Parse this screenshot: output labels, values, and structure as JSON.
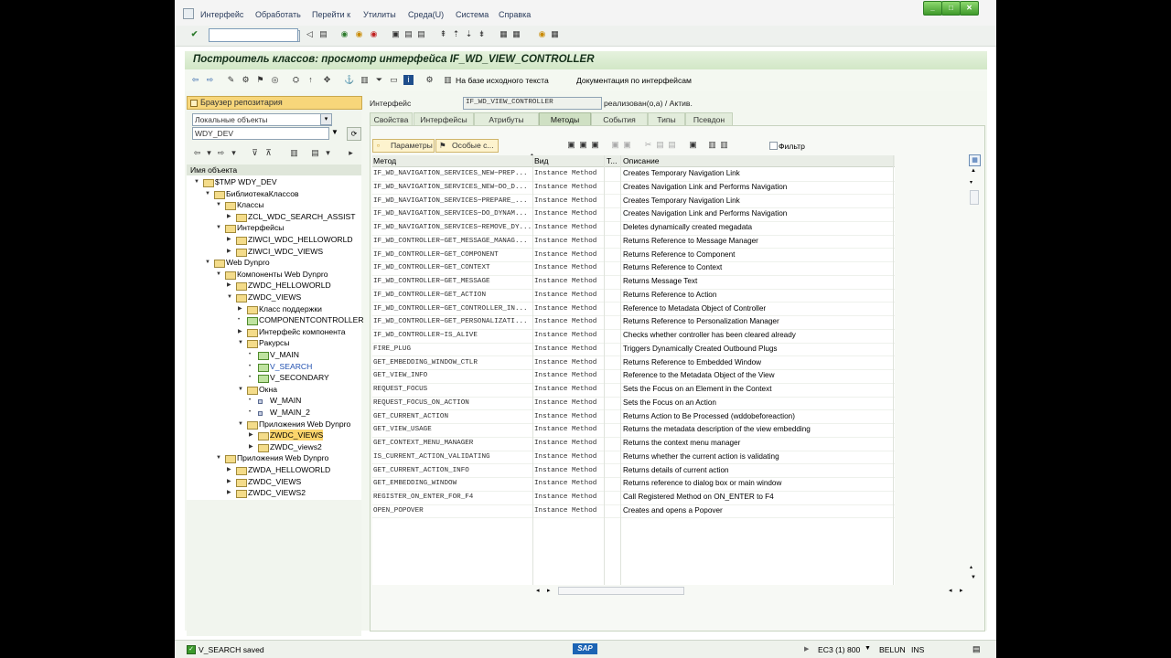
{
  "menubar": {
    "items": [
      "Интерфейс",
      "Обработать",
      "Перейти к",
      "Утилиты",
      "Среда(U)",
      "Система",
      "Справка"
    ]
  },
  "title": "Построитель классов: просмотр интерфейса IF_WD_VIEW_CONTROLLER",
  "app_toolbar": {
    "source_label": "На базе исходного текста",
    "doc_label": "Документация по интерфейсам"
  },
  "left": {
    "browser_title": "Браузер репозитария",
    "object_type": "Локальные объекты",
    "object_name": "WDY_DEV",
    "tree_header": "Имя объекта",
    "tree": [
      {
        "label": "$TMP WDY_DEV",
        "level": 0,
        "exp": "▼",
        "icon": "folder"
      },
      {
        "label": "БиблиотекаКлассов",
        "level": 1,
        "exp": "▼",
        "icon": "folder"
      },
      {
        "label": "Классы",
        "level": 2,
        "exp": "▼",
        "icon": "folder"
      },
      {
        "label": "ZCL_WDC_SEARCH_ASSIST",
        "level": 3,
        "exp": "▶",
        "icon": "folder"
      },
      {
        "label": "Интерфейсы",
        "level": 2,
        "exp": "▼",
        "icon": "folder"
      },
      {
        "label": "ZIWCI_WDC_HELLOWORLD",
        "level": 3,
        "exp": "▶",
        "icon": "folder"
      },
      {
        "label": "ZIWCI_WDC_VIEWS",
        "level": 3,
        "exp": "▶",
        "icon": "folder"
      },
      {
        "label": "Web Dynpro",
        "level": 1,
        "exp": "▼",
        "icon": "folder"
      },
      {
        "label": "Компоненты Web Dynpro",
        "level": 2,
        "exp": "▼",
        "icon": "folder"
      },
      {
        "label": "ZWDC_HELLOWORLD",
        "level": 3,
        "exp": "▶",
        "icon": "folder"
      },
      {
        "label": "ZWDC_VIEWS",
        "level": 3,
        "exp": "▼",
        "icon": "folder"
      },
      {
        "label": "Класс поддержки",
        "level": 4,
        "exp": "▶",
        "icon": "folder"
      },
      {
        "label": "COMPONENTCONTROLLER",
        "level": 4,
        "exp": "•",
        "icon": "obj"
      },
      {
        "label": "Интерфейс компонента",
        "level": 4,
        "exp": "▶",
        "icon": "folder"
      },
      {
        "label": "Ракурсы",
        "level": 4,
        "exp": "▼",
        "icon": "folder"
      },
      {
        "label": "V_MAIN",
        "level": 5,
        "exp": "•",
        "icon": "obj"
      },
      {
        "label": "V_SEARCH",
        "level": 5,
        "exp": "•",
        "icon": "obj",
        "blue": true
      },
      {
        "label": "V_SECONDARY",
        "level": 5,
        "exp": "•",
        "icon": "obj"
      },
      {
        "label": "Окна",
        "level": 4,
        "exp": "▼",
        "icon": "folder"
      },
      {
        "label": "W_MAIN",
        "level": 5,
        "exp": "•",
        "icon": "item"
      },
      {
        "label": "W_MAIN_2",
        "level": 5,
        "exp": "•",
        "icon": "item"
      },
      {
        "label": "Приложения Web Dynpro",
        "level": 4,
        "exp": "▼",
        "icon": "folder"
      },
      {
        "label": "ZWDC_VIEWS",
        "level": 5,
        "exp": "▶",
        "icon": "folder",
        "selected": true
      },
      {
        "label": "ZWDC_views2",
        "level": 5,
        "exp": "▶",
        "icon": "folder"
      },
      {
        "label": "Приложения Web Dynpro",
        "level": 2,
        "exp": "▼",
        "icon": "folder"
      },
      {
        "label": "ZWDA_HELLOWORLD",
        "level": 3,
        "exp": "▶",
        "icon": "folder"
      },
      {
        "label": "ZWDC_VIEWS",
        "level": 3,
        "exp": "▶",
        "icon": "folder"
      },
      {
        "label": "ZWDC_VIEWS2",
        "level": 3,
        "exp": "▶",
        "icon": "folder"
      }
    ]
  },
  "interface": {
    "label": "Интерфейс",
    "value": "IF_WD_VIEW_CONTROLLER",
    "status": "реализован(о,а) / Актив."
  },
  "tabs": [
    "Свойства",
    "Интерфейсы",
    "Атрибуты",
    "Методы",
    "События",
    "Типы",
    "Псевдон"
  ],
  "active_tab": "Методы",
  "methods_toolbar": {
    "params_label": "Параметры",
    "exceptions_label": "Особые с...",
    "filter_label": "Фильтр"
  },
  "grid": {
    "headers": [
      "Метод",
      "Вид",
      "Т...",
      "Описание"
    ],
    "rows": [
      {
        "method": "IF_WD_NAVIGATION_SERVICES_NEW~PREP...",
        "kind": "Instance Method",
        "desc": "Creates Temporary Navigation Link"
      },
      {
        "method": "IF_WD_NAVIGATION_SERVICES_NEW~DO_D...",
        "kind": "Instance Method",
        "desc": "Creates Navigation Link and Performs Navigation"
      },
      {
        "method": "IF_WD_NAVIGATION_SERVICES~PREPARE_...",
        "kind": "Instance Method",
        "desc": "Creates Temporary Navigation Link"
      },
      {
        "method": "IF_WD_NAVIGATION_SERVICES~DO_DYNAM...",
        "kind": "Instance Method",
        "desc": "Creates Navigation Link and Performs Navigation"
      },
      {
        "method": "IF_WD_NAVIGATION_SERVICES~REMOVE_DY...",
        "kind": "Instance Method",
        "desc": "Deletes dynamically created megadata"
      },
      {
        "method": "IF_WD_CONTROLLER~GET_MESSAGE_MANAG...",
        "kind": "Instance Method",
        "desc": "Returns Reference to Message Manager"
      },
      {
        "method": "IF_WD_CONTROLLER~GET_COMPONENT",
        "kind": "Instance Method",
        "desc": "Returns Reference to Component"
      },
      {
        "method": "IF_WD_CONTROLLER~GET_CONTEXT",
        "kind": "Instance Method",
        "desc": "Returns Reference to Context"
      },
      {
        "method": "IF_WD_CONTROLLER~GET_MESSAGE",
        "kind": "Instance Method",
        "desc": "Returns Message Text"
      },
      {
        "method": "IF_WD_CONTROLLER~GET_ACTION",
        "kind": "Instance Method",
        "desc": "Returns Reference to Action"
      },
      {
        "method": "IF_WD_CONTROLLER~GET_CONTROLLER_IN...",
        "kind": "Instance Method",
        "desc": "Reference to Metadata Object of Controller"
      },
      {
        "method": "IF_WD_CONTROLLER~GET_PERSONALIZATI...",
        "kind": "Instance Method",
        "desc": "Returns Reference to Personalization Manager"
      },
      {
        "method": "IF_WD_CONTROLLER~IS_ALIVE",
        "kind": "Instance Method",
        "desc": "Checks whether controller has been cleared already"
      },
      {
        "method": "FIRE_PLUG",
        "kind": "Instance Method",
        "desc": "Triggers Dynamically Created Outbound Plugs"
      },
      {
        "method": "GET_EMBEDDING_WINDOW_CTLR",
        "kind": "Instance Method",
        "desc": "Returns Reference to Embedded Window"
      },
      {
        "method": "GET_VIEW_INFO",
        "kind": "Instance Method",
        "desc": "Reference to the Metadata Object of the View"
      },
      {
        "method": "REQUEST_FOCUS",
        "kind": "Instance Method",
        "desc": "Sets the Focus on an Element in the Context"
      },
      {
        "method": "REQUEST_FOCUS_ON_ACTION",
        "kind": "Instance Method",
        "desc": "Sets the Focus on an Action"
      },
      {
        "method": "GET_CURRENT_ACTION",
        "kind": "Instance Method",
        "desc": "Returns Action to Be Processed (wddobeforeaction)"
      },
      {
        "method": "GET_VIEW_USAGE",
        "kind": "Instance Method",
        "desc": "Returns the metadata description of the view embedding"
      },
      {
        "method": "GET_CONTEXT_MENU_MANAGER",
        "kind": "Instance Method",
        "desc": "Returns the context menu manager"
      },
      {
        "method": "IS_CURRENT_ACTION_VALIDATING",
        "kind": "Instance Method",
        "desc": "Returns whether the current action is validating"
      },
      {
        "method": "GET_CURRENT_ACTION_INFO",
        "kind": "Instance Method",
        "desc": "Returns details of current action"
      },
      {
        "method": "GET_EMBEDDING_WINDOW",
        "kind": "Instance Method",
        "desc": "Returns reference to dialog box or main window"
      },
      {
        "method": "REGISTER_ON_ENTER_FOR_F4",
        "kind": "Instance Method",
        "desc": "Call Registered Method on ON_ENTER to F4"
      },
      {
        "method": "OPEN_POPOVER",
        "kind": "Instance Method",
        "desc": "Creates and opens a Popover"
      }
    ]
  },
  "status": {
    "message": "V_SEARCH saved",
    "system": "EC3 (1) 800",
    "server": "BELUN",
    "mode": "INS",
    "brand": "SAP"
  },
  "colors": {
    "title_bg": "#d7ead0",
    "selection": "#fcd56c",
    "tab_active": "#cfe0c3"
  }
}
